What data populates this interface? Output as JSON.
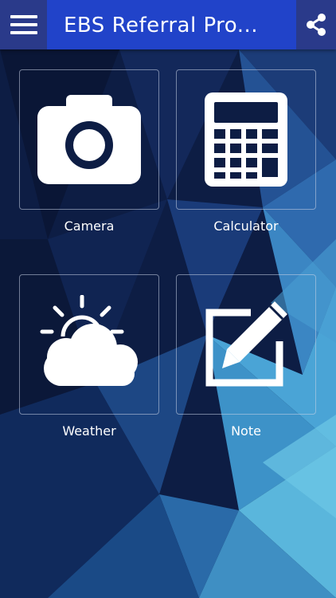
{
  "app_bar": {
    "title": "EBS Referral Pro...",
    "menu_icon": "hamburger-menu-icon",
    "share_icon": "share-icon",
    "color": "#2143c9"
  },
  "tiles": [
    {
      "label": "Camera",
      "icon": "camera-icon"
    },
    {
      "label": "Calculator",
      "icon": "calculator-icon"
    },
    {
      "label": "Weather",
      "icon": "weather-icon"
    },
    {
      "label": "Note",
      "icon": "note-icon"
    }
  ]
}
